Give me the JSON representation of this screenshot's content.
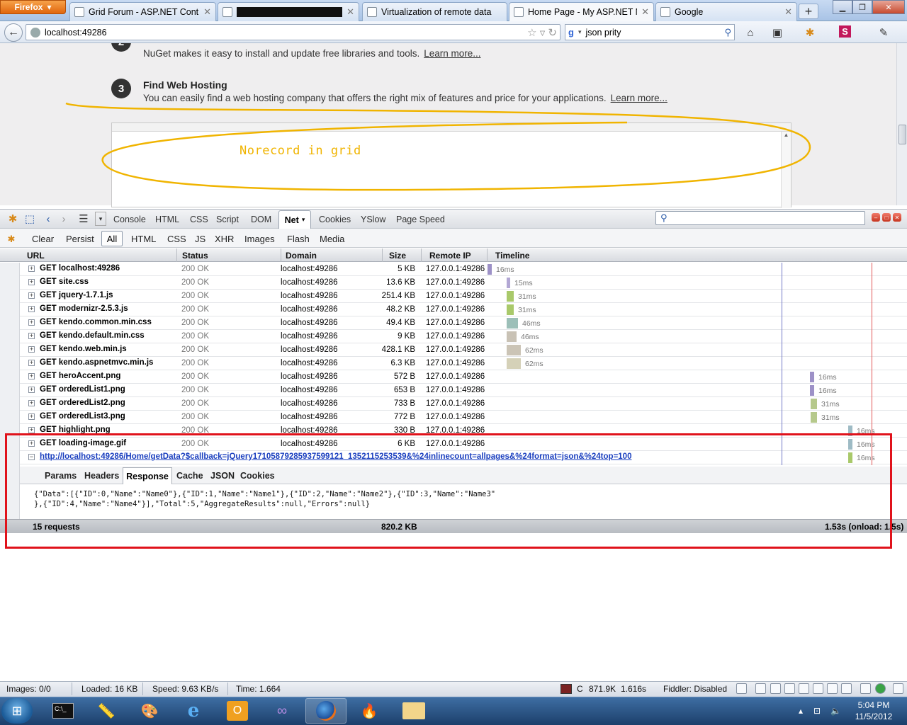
{
  "browser": {
    "menu_label": "Firefox",
    "tabs": [
      {
        "label": "Grid Forum - ASP.NET Contr..."
      },
      {
        "label": "..."
      },
      {
        "label": "Virtualization of remote data"
      },
      {
        "label": "Home Page - My ASP.NET M..."
      },
      {
        "label": "Google"
      }
    ],
    "new_tab": "+",
    "url": "localhost:49286",
    "search_engine": "g",
    "search_value": "json prity"
  },
  "page": {
    "step2_desc": "NuGet makes it easy to install and update free libraries and tools.",
    "step2_link": "Learn more...",
    "step3_number": "3",
    "step3_title": "Find Web Hosting",
    "step3_desc": "You can easily find a web hosting company that offers the right mix of features and price for your applications.",
    "step3_link": "Learn more...",
    "annotation": "Norecord in grid"
  },
  "firebug": {
    "panels": [
      "Console",
      "HTML",
      "CSS",
      "Script",
      "DOM",
      "Net",
      "Cookies",
      "YSlow",
      "Page Speed"
    ],
    "active_panel": "Net",
    "filters": [
      "Clear",
      "Persist",
      "All",
      "HTML",
      "CSS",
      "JS",
      "XHR",
      "Images",
      "Flash",
      "Media"
    ],
    "columns": [
      "URL",
      "Status",
      "Domain",
      "Size",
      "Remote IP",
      "Timeline"
    ],
    "requests": [
      {
        "url": "GET localhost:49286",
        "status": "200 OK",
        "domain": "localhost:49286",
        "size": "5 KB",
        "ip": "127.0.0.1:49286",
        "time": "16ms"
      },
      {
        "url": "GET site.css",
        "status": "200 OK",
        "domain": "localhost:49286",
        "size": "13.6 KB",
        "ip": "127.0.0.1:49286",
        "time": "15ms"
      },
      {
        "url": "GET jquery-1.7.1.js",
        "status": "200 OK",
        "domain": "localhost:49286",
        "size": "251.4 KB",
        "ip": "127.0.0.1:49286",
        "time": "31ms"
      },
      {
        "url": "GET modernizr-2.5.3.js",
        "status": "200 OK",
        "domain": "localhost:49286",
        "size": "48.2 KB",
        "ip": "127.0.0.1:49286",
        "time": "31ms"
      },
      {
        "url": "GET kendo.common.min.css",
        "status": "200 OK",
        "domain": "localhost:49286",
        "size": "49.4 KB",
        "ip": "127.0.0.1:49286",
        "time": "46ms"
      },
      {
        "url": "GET kendo.default.min.css",
        "status": "200 OK",
        "domain": "localhost:49286",
        "size": "9 KB",
        "ip": "127.0.0.1:49286",
        "time": "46ms"
      },
      {
        "url": "GET kendo.web.min.js",
        "status": "200 OK",
        "domain": "localhost:49286",
        "size": "428.1 KB",
        "ip": "127.0.0.1:49286",
        "time": "62ms"
      },
      {
        "url": "GET kendo.aspnetmvc.min.js",
        "status": "200 OK",
        "domain": "localhost:49286",
        "size": "6.3 KB",
        "ip": "127.0.0.1:49286",
        "time": "62ms"
      },
      {
        "url": "GET heroAccent.png",
        "status": "200 OK",
        "domain": "localhost:49286",
        "size": "572 B",
        "ip": "127.0.0.1:49286",
        "time": "16ms"
      },
      {
        "url": "GET orderedList1.png",
        "status": "200 OK",
        "domain": "localhost:49286",
        "size": "653 B",
        "ip": "127.0.0.1:49286",
        "time": "16ms"
      },
      {
        "url": "GET orderedList2.png",
        "status": "200 OK",
        "domain": "localhost:49286",
        "size": "733 B",
        "ip": "127.0.0.1:49286",
        "time": "31ms"
      },
      {
        "url": "GET orderedList3.png",
        "status": "200 OK",
        "domain": "localhost:49286",
        "size": "772 B",
        "ip": "127.0.0.1:49286",
        "time": "31ms"
      },
      {
        "url": "GET highlight.png",
        "status": "200 OK",
        "domain": "localhost:49286",
        "size": "330 B",
        "ip": "127.0.0.1:49286",
        "time": "16ms"
      },
      {
        "url": "GET loading-image.gif",
        "status": "200 OK",
        "domain": "localhost:49286",
        "size": "6 KB",
        "ip": "127.0.0.1:49286",
        "time": "16ms"
      },
      {
        "url": "http://localhost:49286/Home/getData?$callback=jQuery17105879285937599121_1352115253539&%24inlinecount=allpages&%24format=json&%24top=100",
        "status": "",
        "domain": "",
        "size": "",
        "ip": "",
        "time": "16ms"
      }
    ],
    "response_tabs": [
      "Params",
      "Headers",
      "Response",
      "Cache",
      "JSON",
      "Cookies"
    ],
    "active_response_tab": "Response",
    "response_body": "{\"Data\":[{\"ID\":0,\"Name\":\"Name0\"},{\"ID\":1,\"Name\":\"Name1\"},{\"ID\":2,\"Name\":\"Name2\"},{\"ID\":3,\"Name\":\"Name3\"\n},{\"ID\":4,\"Name\":\"Name4\"}],\"Total\":5,\"AggregateResults\":null,\"Errors\":null}",
    "summary": {
      "requests": "15 requests",
      "size": "820.2 KB",
      "time": "1.53s (onload: 1.5s)"
    }
  },
  "statusbar": {
    "images": "Images: 0/0",
    "loaded": "Loaded: 16 KB",
    "speed": "Speed: 9.63 KB/s",
    "time": "Time: 1.664",
    "mem_c": "C",
    "mem": "871.9K",
    "mem_time": "1.616s",
    "fiddler": "Fiddler: Disabled"
  },
  "taskbar": {
    "time": "5:04 PM",
    "date": "11/5/2012"
  },
  "colors": {
    "annotation": "#f0b400",
    "highlight_box": "#e0121b",
    "link": "#1a3fbf"
  }
}
